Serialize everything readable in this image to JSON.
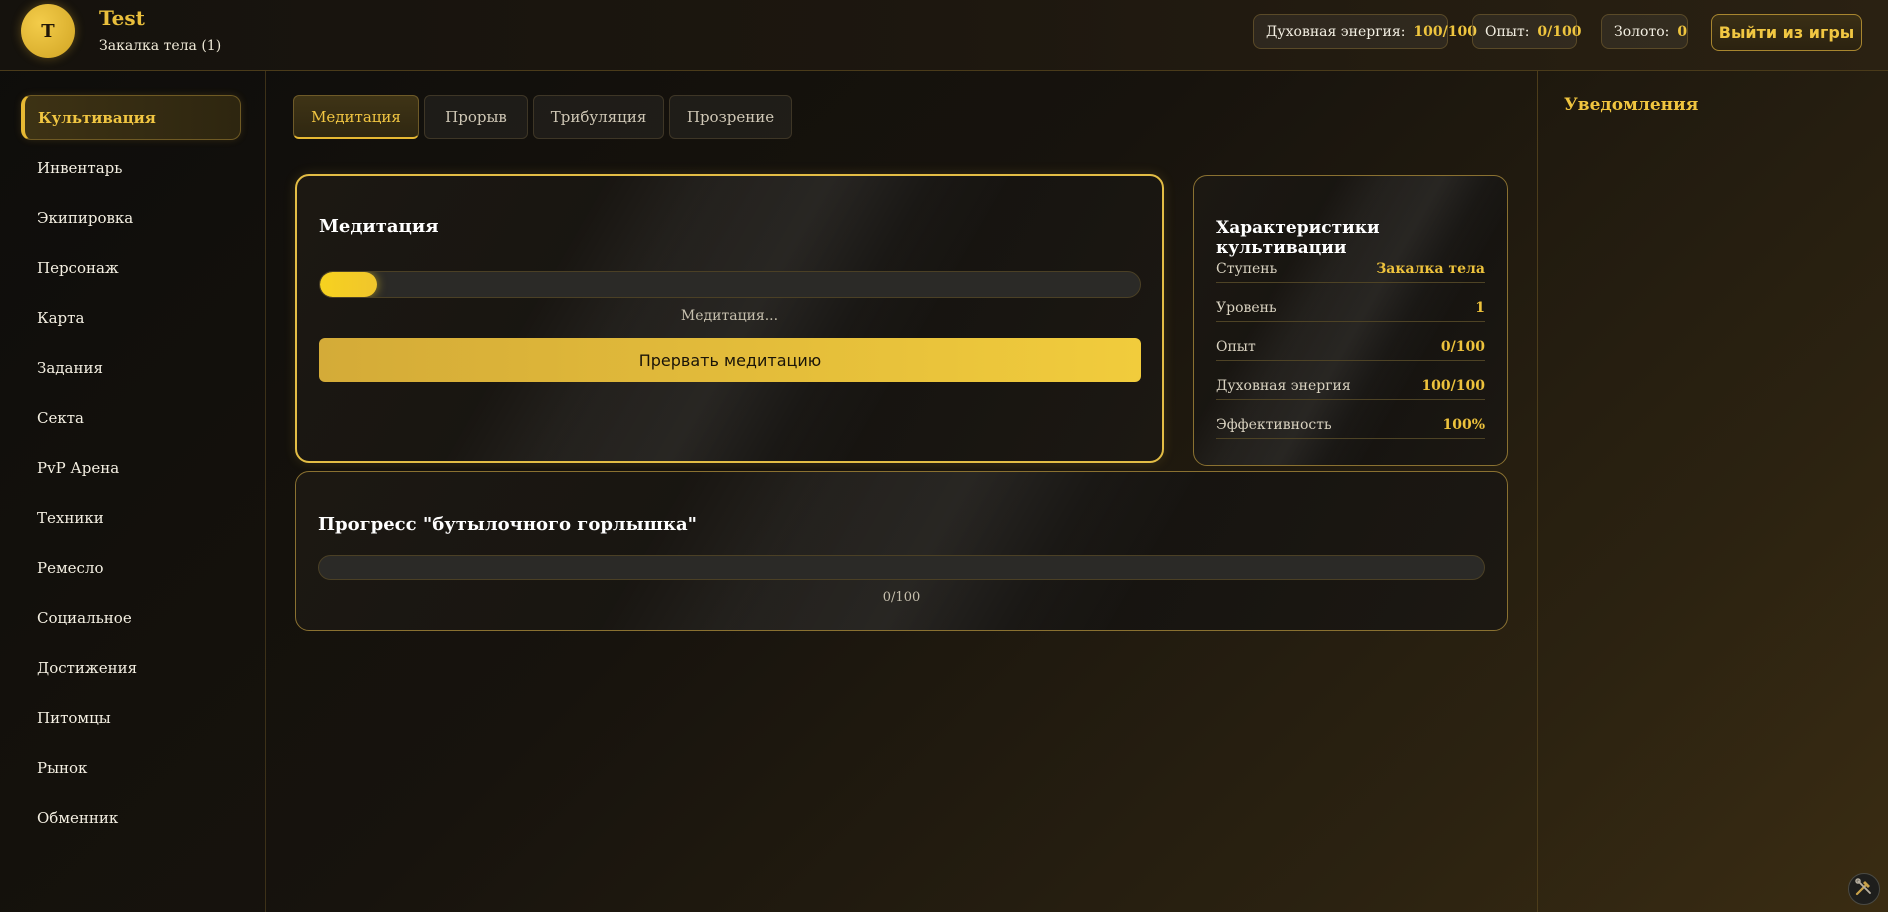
{
  "header": {
    "avatar_letter": "T",
    "player_name": "Test",
    "player_rank": "Закалка тела (1)",
    "stats": [
      {
        "label": "Духовная энергия:",
        "value": "100/100"
      },
      {
        "label": "Опыт:",
        "value": "0/100"
      },
      {
        "label": "Золото:",
        "value": "0"
      }
    ],
    "logout_label": "Выйти из игры"
  },
  "sidebar": {
    "items": [
      {
        "label": "Культивация",
        "active": true
      },
      {
        "label": "Инвентарь"
      },
      {
        "label": "Экипировка"
      },
      {
        "label": "Персонаж"
      },
      {
        "label": "Карта"
      },
      {
        "label": "Задания"
      },
      {
        "label": "Секта"
      },
      {
        "label": "PvP Арена"
      },
      {
        "label": "Техники"
      },
      {
        "label": "Ремесло"
      },
      {
        "label": "Социальное"
      },
      {
        "label": "Достижения"
      },
      {
        "label": "Питомцы"
      },
      {
        "label": "Рынок"
      },
      {
        "label": "Обменник"
      }
    ]
  },
  "tabs": [
    {
      "label": "Медитация",
      "active": true
    },
    {
      "label": "Прорыв"
    },
    {
      "label": "Трибуляция"
    },
    {
      "label": "Прозрение"
    }
  ],
  "meditation": {
    "title": "Медитация",
    "progress_fraction": 0.07,
    "status": "Медитация...",
    "stop_label": "Прервать медитацию"
  },
  "cultivation_stats": {
    "title": "Характеристики культивации",
    "rows": [
      {
        "label": "Ступень",
        "value": "Закалка тела"
      },
      {
        "label": "Уровень",
        "value": "1"
      },
      {
        "label": "Опыт",
        "value": "0/100"
      },
      {
        "label": "Духовная энергия",
        "value": "100/100"
      },
      {
        "label": "Эффективность",
        "value": "100%"
      }
    ]
  },
  "bottleneck": {
    "title": "Прогресс \"бутылочного горлышка\"",
    "progress_fraction": 0,
    "label": "0/100"
  },
  "notifications": {
    "title": "Уведомления"
  },
  "icons": {
    "tools": "tools-icon"
  },
  "colors": {
    "accent": "#e9bf3c",
    "progress": "#f7d21f"
  }
}
